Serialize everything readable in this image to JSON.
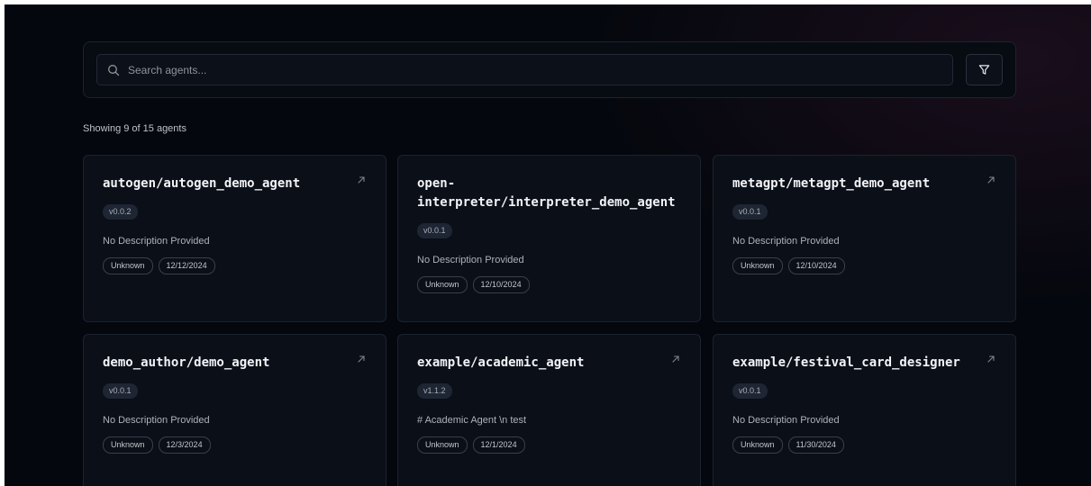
{
  "search": {
    "placeholder": "Search agents..."
  },
  "results": {
    "summary": "Showing 9 of 15 agents"
  },
  "colors": {
    "background": "#04070d",
    "card": "#0a0f18",
    "border": "#1c232f",
    "badge": "#1e2533"
  },
  "icons": {
    "search": "search-icon",
    "filter": "filter-icon",
    "link": "arrow-up-right-icon"
  },
  "cards": [
    {
      "title": "autogen/autogen_demo_agent",
      "version": "v0.0.2",
      "description": "No Description Provided",
      "status": "Unknown",
      "date": "12/12/2024"
    },
    {
      "title": "open-interpreter/interpreter_demo_agent",
      "version": "v0.0.1",
      "description": "No Description Provided",
      "status": "Unknown",
      "date": "12/10/2024"
    },
    {
      "title": "metagpt/metagpt_demo_agent",
      "version": "v0.0.1",
      "description": "No Description Provided",
      "status": "Unknown",
      "date": "12/10/2024"
    },
    {
      "title": "demo_author/demo_agent",
      "version": "v0.0.1",
      "description": "No Description Provided",
      "status": "Unknown",
      "date": "12/3/2024"
    },
    {
      "title": "example/academic_agent",
      "version": "v1.1.2",
      "description": "# Academic Agent \\n test",
      "status": "Unknown",
      "date": "12/1/2024"
    },
    {
      "title": "example/festival_card_designer",
      "version": "v0.0.1",
      "description": "No Description Provided",
      "status": "Unknown",
      "date": "11/30/2024"
    }
  ]
}
